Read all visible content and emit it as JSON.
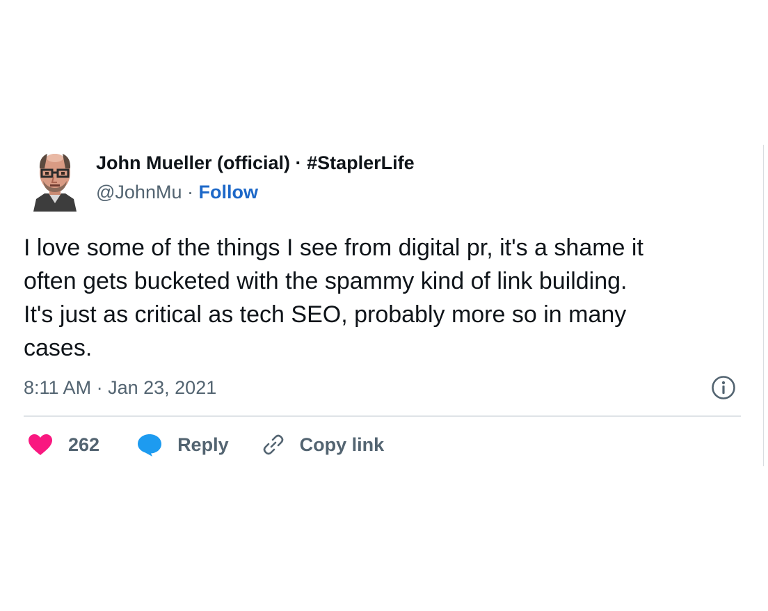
{
  "author": {
    "name": "John Mueller (official)",
    "separator": "·",
    "tag": "#StaplerLife",
    "handle": "@JohnMu",
    "follow_label": "Follow",
    "avatar_icon": "pixel-portrait-avatar"
  },
  "tweet": {
    "lines": [
      "I love some of the things I see from digital pr, it's a shame it",
      "often gets bucketed with the spammy kind of link building.",
      "It's just as critical as tech SEO, probably more so in many",
      "cases."
    ]
  },
  "meta": {
    "time": "8:11 AM",
    "separator": "·",
    "date": "Jan 23, 2021",
    "info_icon": "info-icon"
  },
  "actions": {
    "like_count": "262",
    "like_icon": "heart-icon",
    "reply_label": "Reply",
    "reply_icon": "speech-bubble-icon",
    "copy_label": "Copy link",
    "copy_icon": "link-icon"
  },
  "colors": {
    "like": "#f91880",
    "reply": "#1d9bf0",
    "follow": "#1d68c8",
    "muted": "#536471",
    "text": "#0f1419"
  }
}
